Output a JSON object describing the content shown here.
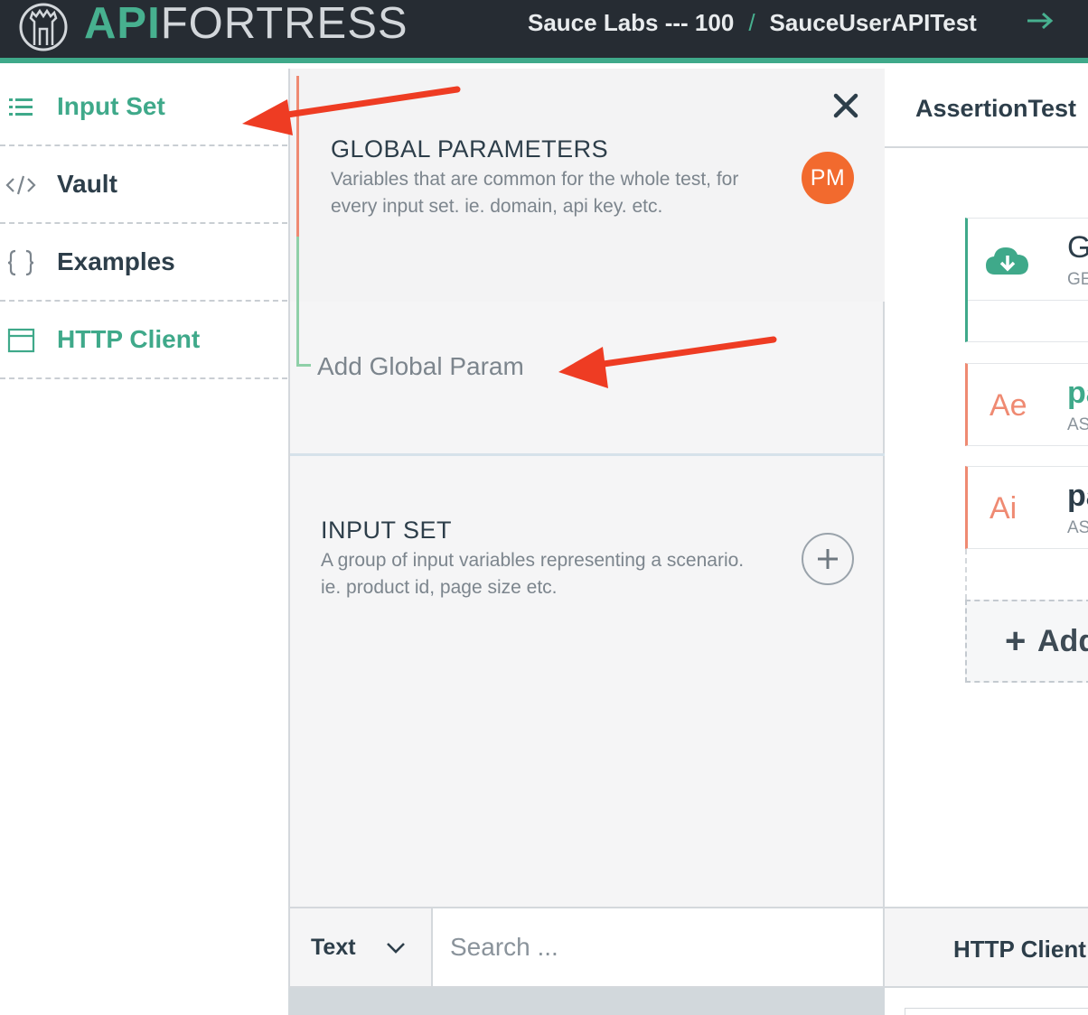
{
  "header": {
    "logo": {
      "brand_strong": "API",
      "brand_light": "FORTRESS"
    },
    "breadcrumb": {
      "company": "Sauce Labs --- 100",
      "separator": "/",
      "test": "SauceUserAPITest"
    },
    "accent_color": "#47b08f",
    "background_color": "#262c33"
  },
  "sidebar": {
    "items": [
      {
        "label": "Input Set",
        "icon": "list-icon",
        "active": true
      },
      {
        "label": "Vault",
        "icon": "code-icon",
        "active": false
      },
      {
        "label": "Examples",
        "icon": "braces-icon",
        "active": false
      },
      {
        "label": "HTTP Client",
        "icon": "browser-window-icon",
        "active": false
      }
    ]
  },
  "panel": {
    "global_parameters": {
      "title": "GLOBAL PARAMETERS",
      "description": "Variables that are common for the whole test, for every input set. ie. domain, api key. etc.",
      "badge": "PM",
      "badge_color": "#f26a2e",
      "add_link": "Add Global Param"
    },
    "input_set": {
      "title": "INPUT SET",
      "description": "A group of input variables representing a scenario. ie. product id, page size etc."
    }
  },
  "search": {
    "type_value": "Text",
    "placeholder": "Search ..."
  },
  "right": {
    "tab": "AssertionTest",
    "cards": [
      {
        "glyph": "cloud-download-icon",
        "title": "G",
        "sub": "GE"
      },
      {
        "glyph": "Ae",
        "title": "pa",
        "sub": "AS"
      },
      {
        "glyph": "Ai",
        "title": "pa",
        "sub": "AS"
      }
    ],
    "add_plus": "+",
    "add_label": "Add",
    "http_tab": "HTTP Client"
  },
  "annotation_color": "#ee3c23"
}
